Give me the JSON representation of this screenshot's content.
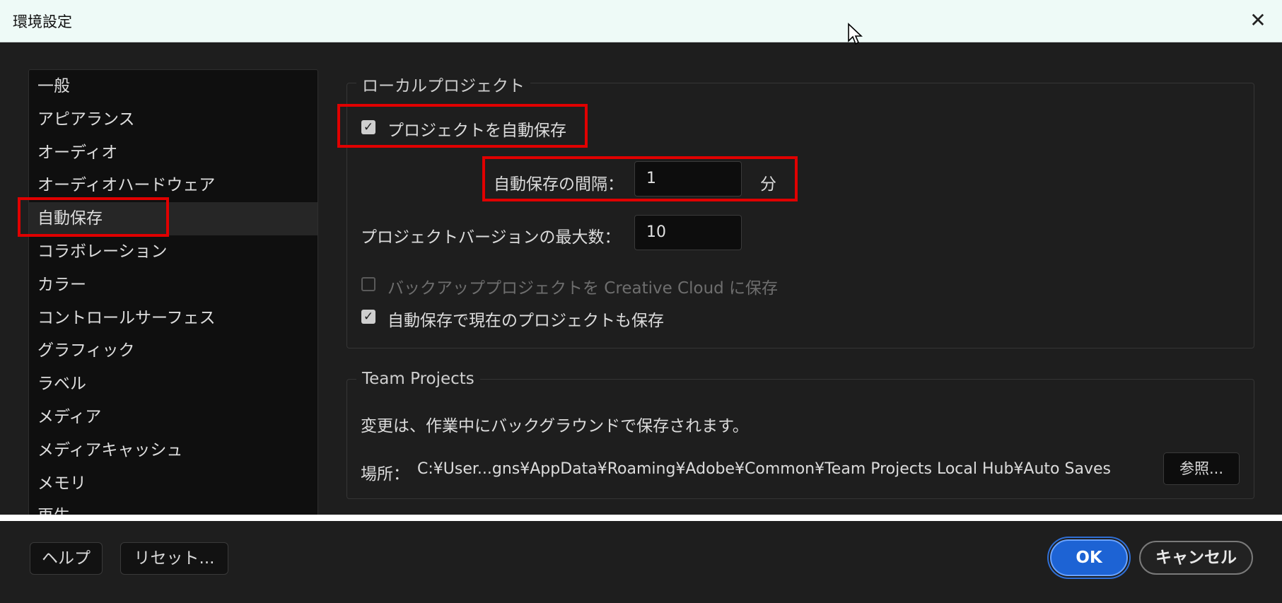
{
  "window": {
    "title": "環境設定"
  },
  "sidebar": {
    "items": [
      {
        "label": "一般"
      },
      {
        "label": "アピアランス"
      },
      {
        "label": "オーディオ"
      },
      {
        "label": "オーディオハードウェア"
      },
      {
        "label": "自動保存",
        "selected": true
      },
      {
        "label": "コラボレーション"
      },
      {
        "label": "カラー"
      },
      {
        "label": "コントロールサーフェス"
      },
      {
        "label": "グラフィック"
      },
      {
        "label": "ラベル"
      },
      {
        "label": "メディア"
      },
      {
        "label": "メディアキャッシュ"
      },
      {
        "label": "メモリ"
      },
      {
        "label": "再生"
      }
    ]
  },
  "local_project": {
    "legend": "ローカルプロジェクト",
    "autosave_checkbox": {
      "label": "プロジェクトを自動保存",
      "checked": true
    },
    "interval": {
      "label": "自動保存の間隔：",
      "value": "1",
      "unit": "分"
    },
    "max_versions": {
      "label": "プロジェクトバージョンの最大数：",
      "value": "10"
    },
    "backup_checkbox": {
      "label": "バックアッププロジェクトを Creative Cloud に保存",
      "checked": false,
      "disabled": true
    },
    "save_current_checkbox": {
      "label": "自動保存で現在のプロジェクトも保存",
      "checked": true
    }
  },
  "team_projects": {
    "legend": "Team Projects",
    "description": "変更は、作業中にバックグラウンドで保存されます。",
    "location_label": "場所：",
    "location_path": "C:¥User...gns¥AppData¥Roaming¥Adobe¥Common¥Team Projects Local Hub¥Auto Saves",
    "browse_label": "参照..."
  },
  "footer": {
    "help_label": "ヘルプ",
    "reset_label": "リセット...",
    "ok_label": "OK",
    "cancel_label": "キャンセル"
  },
  "colors": {
    "accent": "#1d63d4",
    "highlight": "#e00000",
    "background": "#1e1e1e"
  }
}
